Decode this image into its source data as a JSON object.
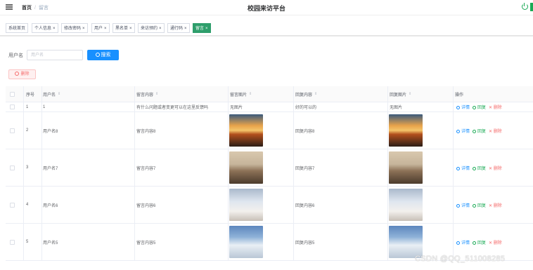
{
  "header": {
    "breadcrumb_home": "首页",
    "breadcrumb_sep": "/",
    "breadcrumb_current": "留言",
    "title": "校园来访平台",
    "icons": [
      "menu-icon",
      "power-icon"
    ]
  },
  "tags": [
    {
      "label": "系统首页",
      "close": ""
    },
    {
      "label": "个人信息",
      "close": "×"
    },
    {
      "label": "修改密码",
      "close": "×"
    },
    {
      "label": "用户",
      "close": "×"
    },
    {
      "label": "黑名单",
      "close": "×"
    },
    {
      "label": "来访预约",
      "close": "×"
    },
    {
      "label": "通行码",
      "close": "×"
    },
    {
      "label": "留言",
      "close": "×",
      "active": true
    }
  ],
  "search": {
    "label": "用户名",
    "placeholder": "用户名",
    "value": "",
    "button_label": "搜索"
  },
  "delete_button": "删除",
  "table": {
    "columns": [
      "",
      "序号",
      "用户名",
      "留言内容",
      "留言图片",
      "回复内容",
      "回复图片",
      "操作"
    ],
    "sort_glyph": "⇕",
    "operations": {
      "detail": "详情",
      "reply": "回复",
      "delete": "删除"
    },
    "rows": [
      {
        "index": "1",
        "username": "1",
        "message": "有什么问题或者变更可以在这里反馈吗",
        "message_image": "无图片",
        "reply": "好的可以的",
        "reply_image": "无图片"
      },
      {
        "index": "2",
        "username": "用户名8",
        "message": "留言内容8",
        "message_image": "sunset",
        "reply": "回复内容8",
        "reply_image": "sunset"
      },
      {
        "index": "3",
        "username": "用户名7",
        "message": "留言内容7",
        "message_image": "people",
        "reply": "回复内容7",
        "reply_image": "people"
      },
      {
        "index": "4",
        "username": "用户名6",
        "message": "留言内容6",
        "message_image": "fog",
        "reply": "回复内容6",
        "reply_image": "fog"
      },
      {
        "index": "5",
        "username": "用户名5",
        "message": "留言内容5",
        "message_image": "snow",
        "reply": "回复内容5",
        "reply_image": "snow"
      }
    ]
  },
  "watermark": "CSDN @QQ_511008285",
  "colors": {
    "primary": "#1890ff",
    "success": "#1aaa55",
    "danger": "#f56c6c",
    "tag_active": "#2e9e6b"
  }
}
